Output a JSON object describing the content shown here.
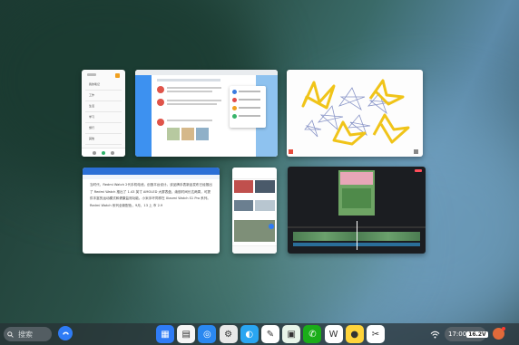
{
  "search": {
    "placeholder": "搜索"
  },
  "dock": {
    "icons": [
      {
        "name": "app-grid-icon",
        "bg": "#2f7cf6",
        "glyph": "▦"
      },
      {
        "name": "file-manager-icon",
        "bg": "#f5f5f5",
        "glyph": "▤"
      },
      {
        "name": "browser-icon",
        "bg": "#2a88f0",
        "glyph": "◎"
      },
      {
        "name": "settings-icon",
        "bg": "#e8e8e8",
        "glyph": "⚙"
      },
      {
        "name": "app-store-icon",
        "bg": "#2aa6f2",
        "glyph": "◐"
      },
      {
        "name": "notes-icon",
        "bg": "#ffffff",
        "glyph": "✎"
      },
      {
        "name": "gallery-icon",
        "bg": "#e8f5e9",
        "glyph": "▣"
      },
      {
        "name": "wechat-icon",
        "bg": "#1aad19",
        "glyph": "✆"
      },
      {
        "name": "wps-office-icon",
        "bg": "#ffffff",
        "glyph": "W"
      },
      {
        "name": "qq-icon",
        "bg": "#ffd43b",
        "glyph": "●"
      },
      {
        "name": "capcut-icon",
        "bg": "#ffffff",
        "glyph": "✂"
      }
    ]
  },
  "status": {
    "time": "17:00",
    "battery": "16.2V"
  },
  "memo_app": {
    "items": [
      "我的笔记",
      "工作",
      "生活",
      "学习",
      "旅行",
      "其他"
    ]
  },
  "document": {
    "body": "当时代，Redmi Watch 2代手机电池，创造平台设计。该品牌手表新品发布已经推出了 Redmi Watch 推出了 1.43 英寸 AMOLED 大屏表盘，续航时间长达两周，可提供丰富的运动模式和健康监测功能。小米手环同样在 Xiaomi Watch S1 Pro 系列。Redmi Watch 系列全新配色，9月，13 上 市 2.9"
  }
}
